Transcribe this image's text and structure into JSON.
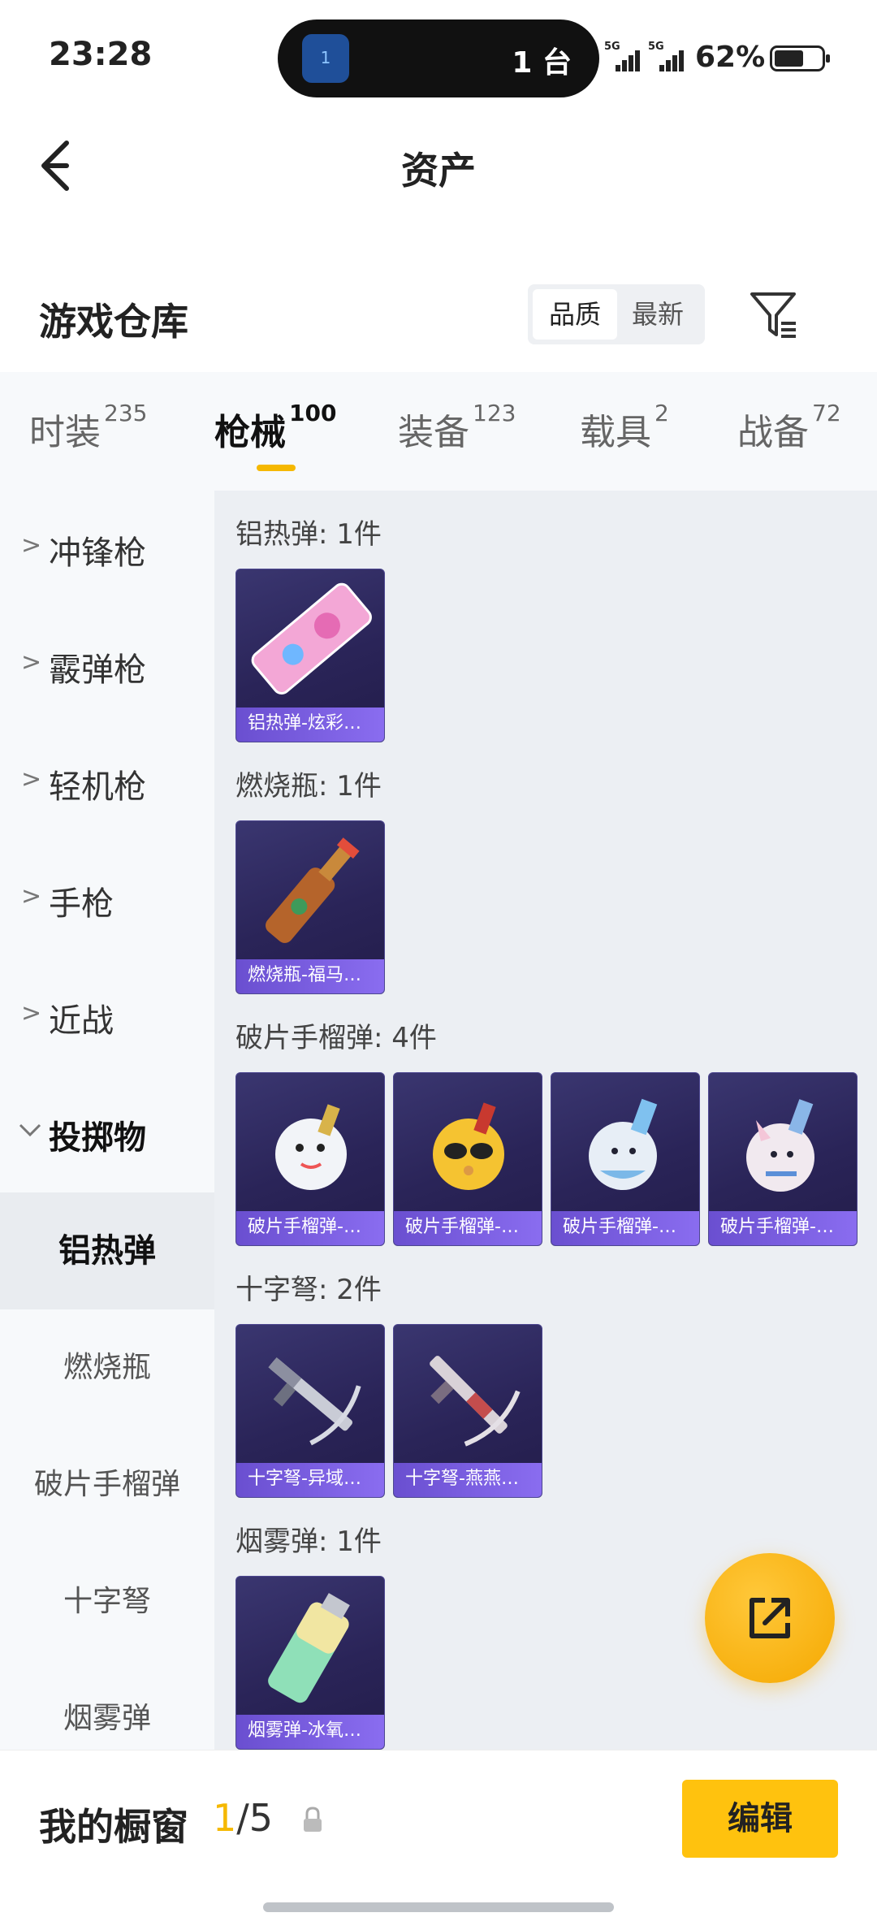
{
  "status_bar": {
    "time": "23:28",
    "island_badge": "1",
    "island_text": "1 台",
    "network_1": "5G",
    "network_2": "5G",
    "battery_percent": "62%",
    "battery_level": 0.62
  },
  "header": {
    "title": "资产",
    "back_icon": "back-arrow-icon"
  },
  "warehouse": {
    "title": "游戏仓库",
    "sort_options": [
      "品质",
      "最新"
    ],
    "sort_selected": "品质",
    "filter_icon": "filter-icon"
  },
  "tabs": [
    {
      "label": "时装",
      "count": "235"
    },
    {
      "label": "枪械",
      "count": "100",
      "active": true
    },
    {
      "label": "装备",
      "count": "123"
    },
    {
      "label": "载具",
      "count": "2"
    },
    {
      "label": "战备",
      "count": "72"
    }
  ],
  "sidebar": {
    "categories": [
      "冲锋枪",
      "霰弹枪",
      "轻机枪",
      "手枪",
      "近战",
      "投掷物"
    ],
    "open_category": "投掷物",
    "subcategories": [
      "铝热弹",
      "燃烧瓶",
      "破片手榴弹",
      "十字弩",
      "烟雾弹"
    ],
    "active_subcategory": "铝热弹"
  },
  "groups": [
    {
      "title": "铝热弹: 1件",
      "items": [
        "铝热弹-炫彩…"
      ]
    },
    {
      "title": "燃烧瓶: 1件",
      "items": [
        "燃烧瓶-福马…"
      ]
    },
    {
      "title": "破片手榴弹: 4件",
      "items": [
        "破片手榴弹-…",
        "破片手榴弹-…",
        "破片手榴弹-…",
        "破片手榴弹-…"
      ]
    },
    {
      "title": "十字弩: 2件",
      "items": [
        "十字弩-异域…",
        "十字弩-燕燕…"
      ]
    },
    {
      "title": "烟雾弹: 1件",
      "items": [
        "烟雾弹-冰氧…"
      ]
    }
  ],
  "fab": {
    "icon": "share-icon"
  },
  "bottom": {
    "showcase_label": "我的橱窗",
    "showcase_current": "1",
    "showcase_total": "/5",
    "lock_icon": "lock-icon",
    "edit_label": "编辑"
  },
  "colors": {
    "accent": "#f5b800",
    "card_caption": "#7b5ee6",
    "card_bg": "#2a2458"
  }
}
